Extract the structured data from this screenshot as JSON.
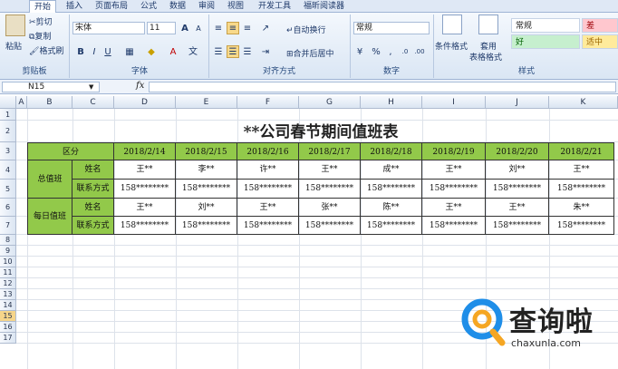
{
  "tabs": [
    "开始",
    "插入",
    "页面布局",
    "公式",
    "数据",
    "审阅",
    "视图",
    "开发工具",
    "福昕阅读器"
  ],
  "clipboard": {
    "paste": "粘贴",
    "cut": "剪切",
    "copy": "复制",
    "format_painter": "格式刷",
    "group": "剪贴板"
  },
  "font": {
    "name": "宋体",
    "size": "11",
    "group": "字体"
  },
  "alignment": {
    "wrap": "自动换行",
    "merge": "合并后居中",
    "group": "对齐方式"
  },
  "number": {
    "format": "常规",
    "group": "数字"
  },
  "styles": {
    "cond_format": "条件格式",
    "table_format_1": "套用",
    "table_format_2": "表格格式",
    "normal": "常规",
    "bad": "差",
    "good": "好",
    "neutral": "适中",
    "group": "样式"
  },
  "colors": {
    "green_fill": "#92c94a",
    "good_fill": "#c6efce",
    "bad_fill": "#ffc7ce",
    "neutral_fill": "#ffeb9c"
  },
  "formula_bar": {
    "name_box": "N15",
    "fx": "fx",
    "value": ""
  },
  "columns": [
    "A",
    "B",
    "C",
    "D",
    "E",
    "F",
    "G",
    "H",
    "I",
    "J",
    "K"
  ],
  "rows": [
    "1",
    "2",
    "3",
    "4",
    "5",
    "6",
    "7",
    "8",
    "9",
    "10",
    "11",
    "12",
    "13",
    "14",
    "15",
    "16",
    "17"
  ],
  "sheet": {
    "title": "**公司春节期间值班表",
    "header_label": "区分",
    "dates": [
      "2018/2/14",
      "2018/2/15",
      "2018/2/16",
      "2018/2/17",
      "2018/2/18",
      "2018/2/19",
      "2018/2/20",
      "2018/2/21"
    ],
    "groups": [
      {
        "name": "总值班",
        "name_label": "姓名",
        "contact_label": "联系方式",
        "names": [
          "王**",
          "李**",
          "许**",
          "王**",
          "成**",
          "王**",
          "刘**",
          "王**"
        ],
        "contacts": [
          "158********",
          "158********",
          "158********",
          "158********",
          "158********",
          "158********",
          "158********",
          "158********"
        ]
      },
      {
        "name": "每日值班",
        "name_label": "姓名",
        "contact_label": "联系方式",
        "names": [
          "王**",
          "刘**",
          "王**",
          "张**",
          "陈**",
          "王**",
          "王**",
          "朱**"
        ],
        "contacts": [
          "158********",
          "158********",
          "158********",
          "158********",
          "158********",
          "158********",
          "158********",
          "158********"
        ]
      }
    ]
  },
  "watermark": {
    "text": "查询啦",
    "url": "chaxunla.com"
  }
}
